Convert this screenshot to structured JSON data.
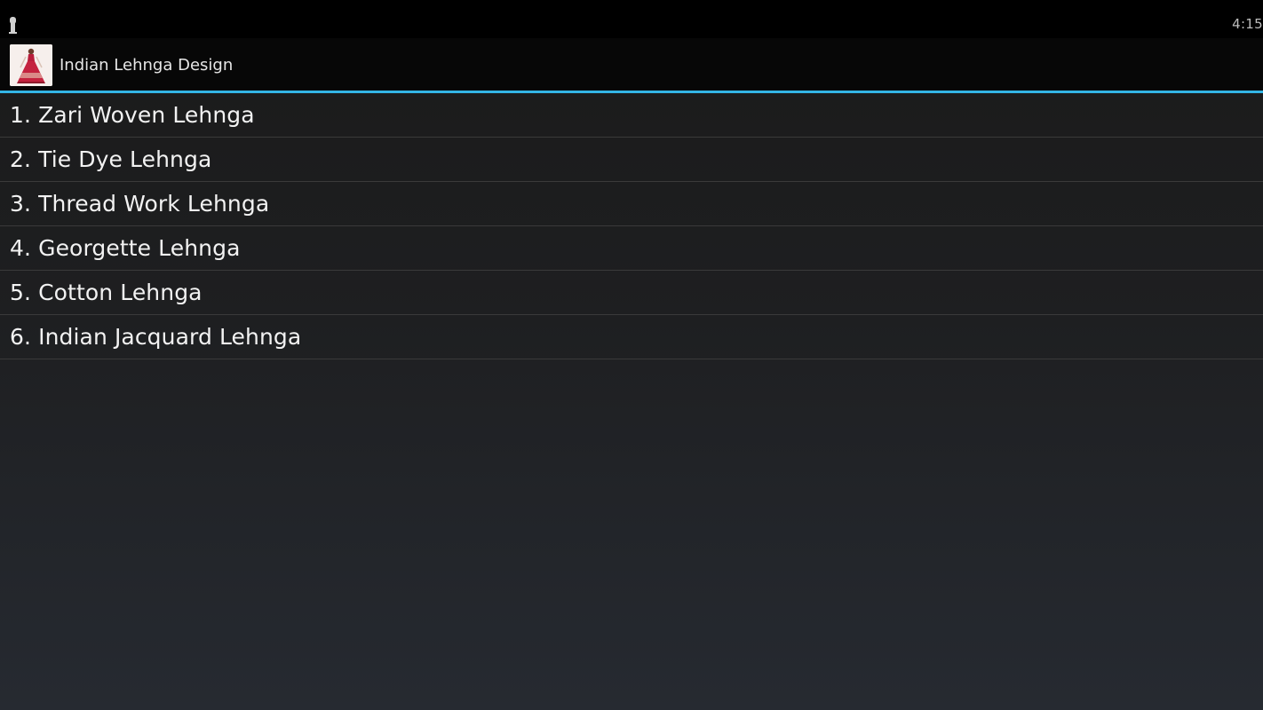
{
  "status_bar": {
    "clock": "4:15",
    "notification_icon": "usb-icon"
  },
  "action_bar": {
    "app_icon": "lehenga-thumbnail-icon",
    "title": "Indian Lehnga Design",
    "accent_color": "#33b5e5"
  },
  "list": {
    "items": [
      {
        "label": "1. Zari Woven Lehnga"
      },
      {
        "label": "2. Tie Dye Lehnga"
      },
      {
        "label": "3. Thread Work Lehnga"
      },
      {
        "label": "4. Georgette Lehnga"
      },
      {
        "label": "5. Cotton Lehnga"
      },
      {
        "label": "6. Indian Jacquard Lehnga"
      }
    ]
  }
}
